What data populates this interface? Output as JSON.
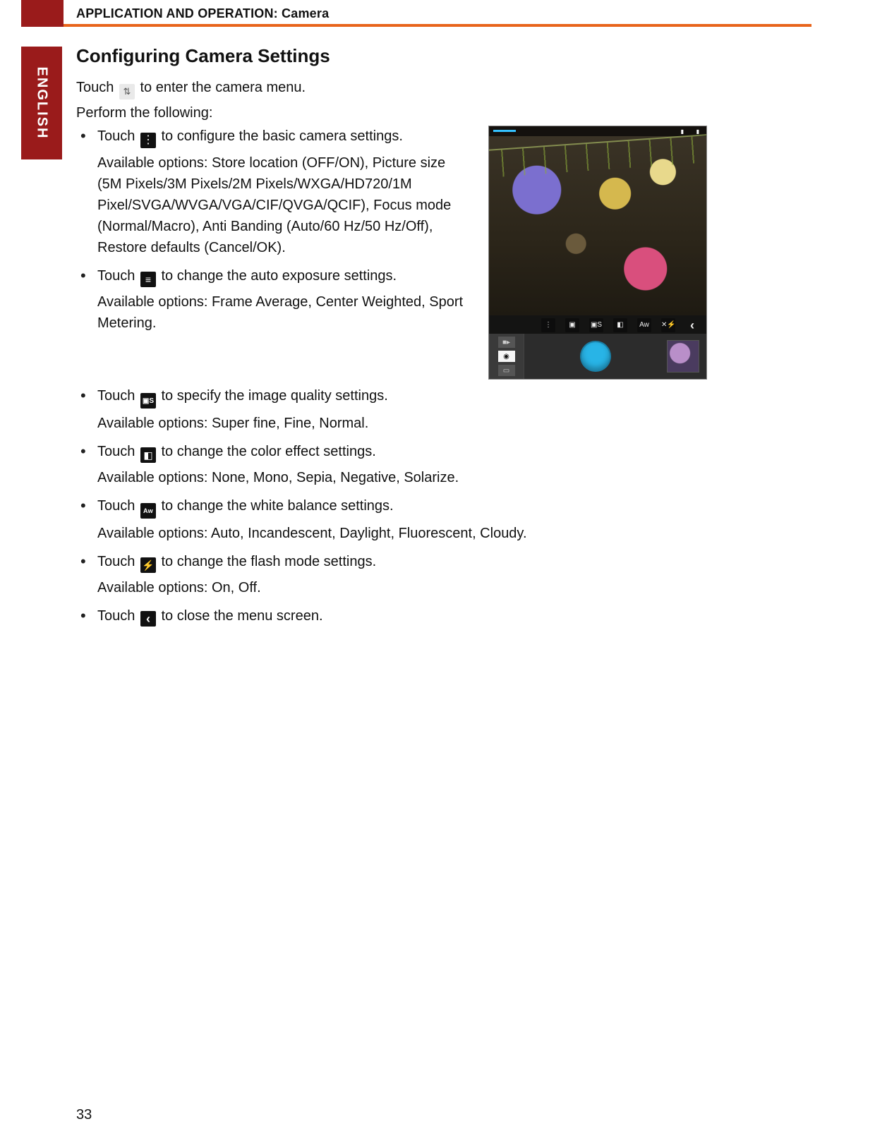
{
  "header": {
    "title": "APPLICATION AND OPERATION: Camera"
  },
  "sidebar": {
    "language": "ENGLISH"
  },
  "page_number": "33",
  "section": {
    "title": "Configuring Camera Settings",
    "intro_before": "Touch ",
    "intro_after": " to enter the camera menu.",
    "perform": "Perform the following:",
    "items": [
      {
        "before": "Touch ",
        "after": " to configure the basic camera settings.",
        "options": "Available options: Store location (OFF/ON), Picture size (5M Pixels/3M Pixels/2M Pixels/WXGA/HD720/1M Pixel/SVGA/WVGA/VGA/CIF/QVGA/QCIF), Focus mode (Normal/Macro), Anti Banding (Auto/60 Hz/50 Hz/Off), Restore defaults (Cancel/OK).",
        "icon": "dots"
      },
      {
        "before": "Touch ",
        "after": " to change the auto exposure settings.",
        "options": "Available options: Frame Average, Center Weighted, Sport Metering.",
        "icon": "eq"
      },
      {
        "before": "Touch ",
        "after": " to specify the image quality settings.",
        "options": "Available options: Super fine, Fine, Normal.",
        "icon": "s"
      },
      {
        "before": "Touch ",
        "after": " to change the color effect settings.",
        "options": "Available options: None, Mono, Sepia, Negative, Solarize.",
        "icon": "fx"
      },
      {
        "before": "Touch ",
        "after": " to change the white balance settings.",
        "options": "Available options: Auto, Incandescent, Daylight, Fluorescent, Cloudy.",
        "icon": "aw"
      },
      {
        "before": "Touch ",
        "after": " to change the flash mode settings.",
        "options": "Available options: On, Off.",
        "icon": "flash"
      },
      {
        "before": "Touch ",
        "after": " to close the menu screen.",
        "options": "",
        "icon": "chev"
      }
    ]
  },
  "phone": {
    "icon_row": [
      "⋮",
      "▣",
      "▣S",
      "◧",
      "Aw",
      "✕⚡",
      "‹"
    ],
    "modes": {
      "video": "■▸",
      "camera": "◉",
      "pano": "▭"
    }
  }
}
